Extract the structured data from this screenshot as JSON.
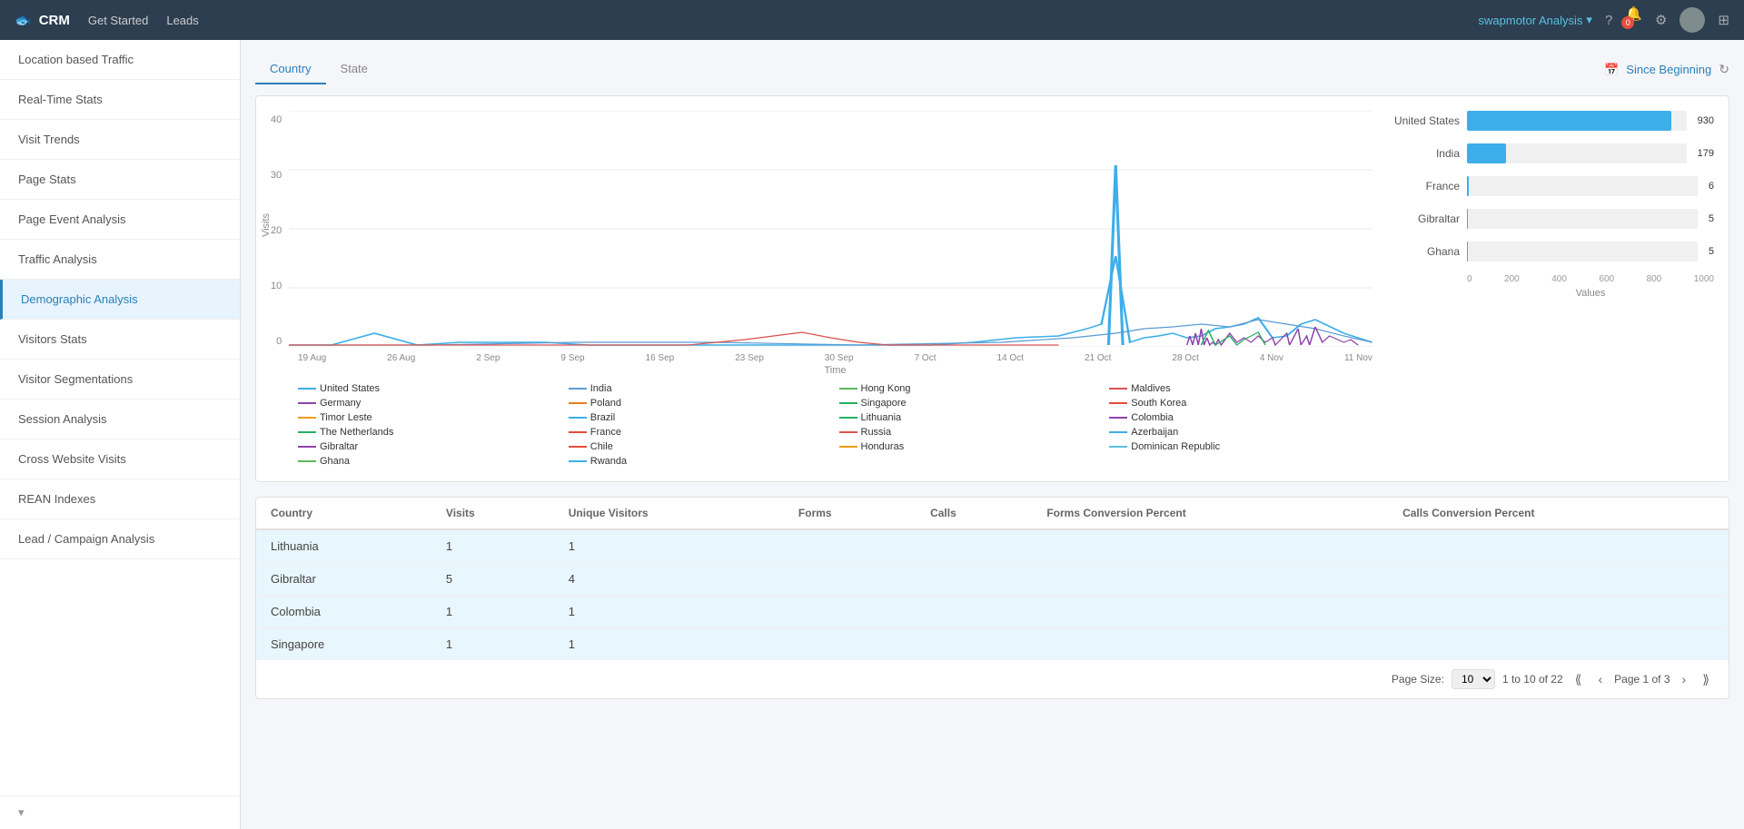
{
  "navbar": {
    "brand": "CRM",
    "logo": "🐟",
    "links": [
      "Get Started",
      "Leads"
    ],
    "analysis_label": "swapmotor Analysis",
    "badge_count": "0"
  },
  "sidebar": {
    "items": [
      {
        "id": "location-based-traffic",
        "label": "Location based Traffic"
      },
      {
        "id": "real-time-stats",
        "label": "Real-Time Stats"
      },
      {
        "id": "visit-trends",
        "label": "Visit Trends"
      },
      {
        "id": "page-stats",
        "label": "Page Stats"
      },
      {
        "id": "page-event-analysis",
        "label": "Page Event Analysis"
      },
      {
        "id": "traffic-analysis",
        "label": "Traffic Analysis"
      },
      {
        "id": "demographic-analysis",
        "label": "Demographic Analysis",
        "active": true
      },
      {
        "id": "visitors-stats",
        "label": "Visitors Stats"
      },
      {
        "id": "visitor-segmentations",
        "label": "Visitor Segmentations"
      },
      {
        "id": "session-analysis",
        "label": "Session Analysis"
      },
      {
        "id": "cross-website-visits",
        "label": "Cross Website Visits"
      },
      {
        "id": "rean-indexes",
        "label": "REAN Indexes"
      },
      {
        "id": "lead-campaign-analysis",
        "label": "Lead / Campaign Analysis"
      }
    ]
  },
  "tabs": [
    {
      "label": "Country",
      "active": true
    },
    {
      "label": "State",
      "active": false
    }
  ],
  "date_filter": "Since Beginning",
  "bar_chart": {
    "countries": [
      {
        "name": "United States",
        "value": 930,
        "max": 1000
      },
      {
        "name": "India",
        "value": 179,
        "max": 1000
      },
      {
        "name": "France",
        "value": 6,
        "max": 1000
      },
      {
        "name": "Gibraltar",
        "value": 5,
        "max": 1000
      },
      {
        "name": "Ghana",
        "value": 5,
        "max": 1000
      }
    ],
    "x_axis": [
      "0",
      "200",
      "400",
      "600",
      "800",
      "1000"
    ],
    "x_label": "Values"
  },
  "line_chart": {
    "y_label": "Visits",
    "y_ticks": [
      "0",
      "10",
      "20",
      "30",
      "40"
    ],
    "x_ticks": [
      "19 Aug",
      "26 Aug",
      "2 Sep",
      "9 Sep",
      "16 Sep",
      "23 Sep",
      "30 Sep",
      "7 Oct",
      "14 Oct",
      "21 Oct",
      "28 Oct",
      "4 Nov",
      "11 Nov"
    ],
    "x_label": "Time"
  },
  "legend": [
    {
      "label": "United States",
      "color": "#3daee9"
    },
    {
      "label": "India",
      "color": "#3daee9"
    },
    {
      "label": "Hong Kong",
      "color": "#5cb85c"
    },
    {
      "label": "Maldives",
      "color": "#d9534f"
    },
    {
      "label": "Germany",
      "color": "#8e44ad"
    },
    {
      "label": "Poland",
      "color": "#e67e22"
    },
    {
      "label": "Singapore",
      "color": "#27ae60"
    },
    {
      "label": "South Korea",
      "color": "#e74c3c"
    },
    {
      "label": "Timor Leste",
      "color": "#f39c12"
    },
    {
      "label": "Brazil",
      "color": "#3daee9"
    },
    {
      "label": "Lithuania",
      "color": "#27ae60"
    },
    {
      "label": "Colombia",
      "color": "#8e44ad"
    },
    {
      "label": "The Netherlands",
      "color": "#27ae60"
    },
    {
      "label": "France",
      "color": "#e74c3c"
    },
    {
      "label": "Russia",
      "color": "#d9534f"
    },
    {
      "label": "Azerbaijan",
      "color": "#3daee9"
    },
    {
      "label": "Gibraltar",
      "color": "#8e44ad"
    },
    {
      "label": "Chile",
      "color": "#e74c3c"
    },
    {
      "label": "Honduras",
      "color": "#f39c12"
    },
    {
      "label": "Dominican Republic",
      "color": "#5bc0de"
    },
    {
      "label": "Ghana",
      "color": "#5cb85c"
    },
    {
      "label": "Rwanda",
      "color": "#3daee9"
    }
  ],
  "table": {
    "columns": [
      "Country",
      "Visits",
      "Unique Visitors",
      "Forms",
      "Calls",
      "Forms Conversion Percent",
      "Calls Conversion Percent"
    ],
    "rows": [
      {
        "country": "Lithuania",
        "visits": "1",
        "unique_visitors": "1",
        "forms": "",
        "calls": "",
        "forms_pct": "",
        "calls_pct": "",
        "highlighted": true
      },
      {
        "country": "Gibraltar",
        "visits": "5",
        "unique_visitors": "4",
        "forms": "",
        "calls": "",
        "forms_pct": "",
        "calls_pct": "",
        "highlighted": true
      },
      {
        "country": "Colombia",
        "visits": "1",
        "unique_visitors": "1",
        "forms": "",
        "calls": "",
        "forms_pct": "",
        "calls_pct": "",
        "highlighted": true
      },
      {
        "country": "Singapore",
        "visits": "1",
        "unique_visitors": "1",
        "forms": "",
        "calls": "",
        "forms_pct": "",
        "calls_pct": "",
        "highlighted": true
      }
    ]
  },
  "pagination": {
    "page_size_label": "Page Size:",
    "range": "1 to 10 of 22",
    "current_page": "Page 1 of 3"
  }
}
